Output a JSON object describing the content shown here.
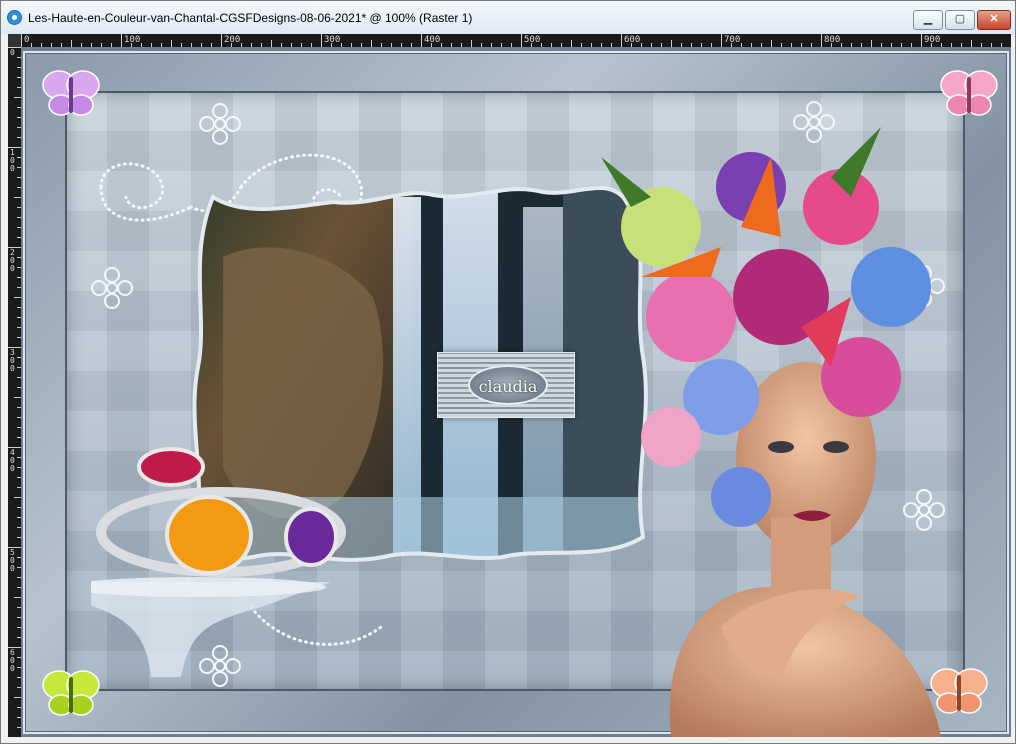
{
  "window": {
    "title": "Les-Haute-en-Couleur-van-Chantal-CGSFDesigns-08-06-2021* @ 100% (Raster 1)",
    "minimize_icon": "minimize-icon",
    "maximize_icon": "maximize-icon",
    "close_icon": "close-icon"
  },
  "ruler": {
    "horizontal_labels": [
      "0",
      "100",
      "200",
      "300",
      "400",
      "500",
      "600",
      "700",
      "800",
      "900"
    ],
    "vertical_labels": [
      "0",
      "100",
      "200",
      "300",
      "400",
      "500",
      "600"
    ]
  },
  "canvas": {
    "watermark_text": "claudia",
    "colors": {
      "frame": "#9aa9b8",
      "background_pattern": "#b4c1ce",
      "accent_pink": "#e4569c",
      "accent_purple": "#7a3fb0"
    }
  }
}
